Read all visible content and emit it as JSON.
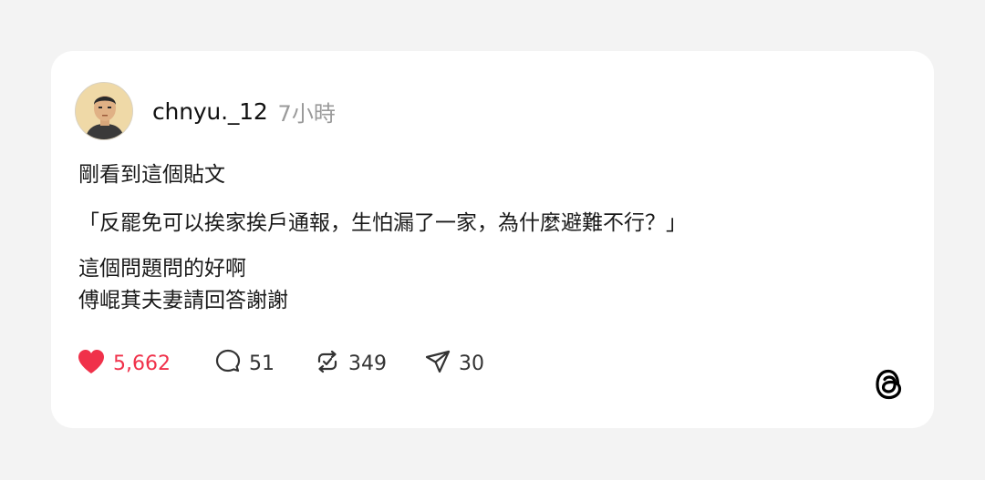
{
  "post": {
    "username": "chnyu._12",
    "time": "7小時",
    "paragraph1": "剛看到這個貼文",
    "paragraph2": "「反罷免可以挨家挨戶通報，生怕漏了一家，為什麼避難不行？」",
    "paragraph3_line1": "這個問題問的好啊",
    "paragraph3_line2": "傅崐萁夫妻請回答謝謝"
  },
  "actions": {
    "likes": "5,662",
    "replies": "51",
    "reposts": "349",
    "shares": "30"
  },
  "colors": {
    "like": "#f0314a",
    "text": "#1a1a1a",
    "muted": "#9a9a9a"
  },
  "icons": [
    "heart-icon",
    "comment-icon",
    "repost-icon",
    "share-icon",
    "threads-logo-icon"
  ]
}
